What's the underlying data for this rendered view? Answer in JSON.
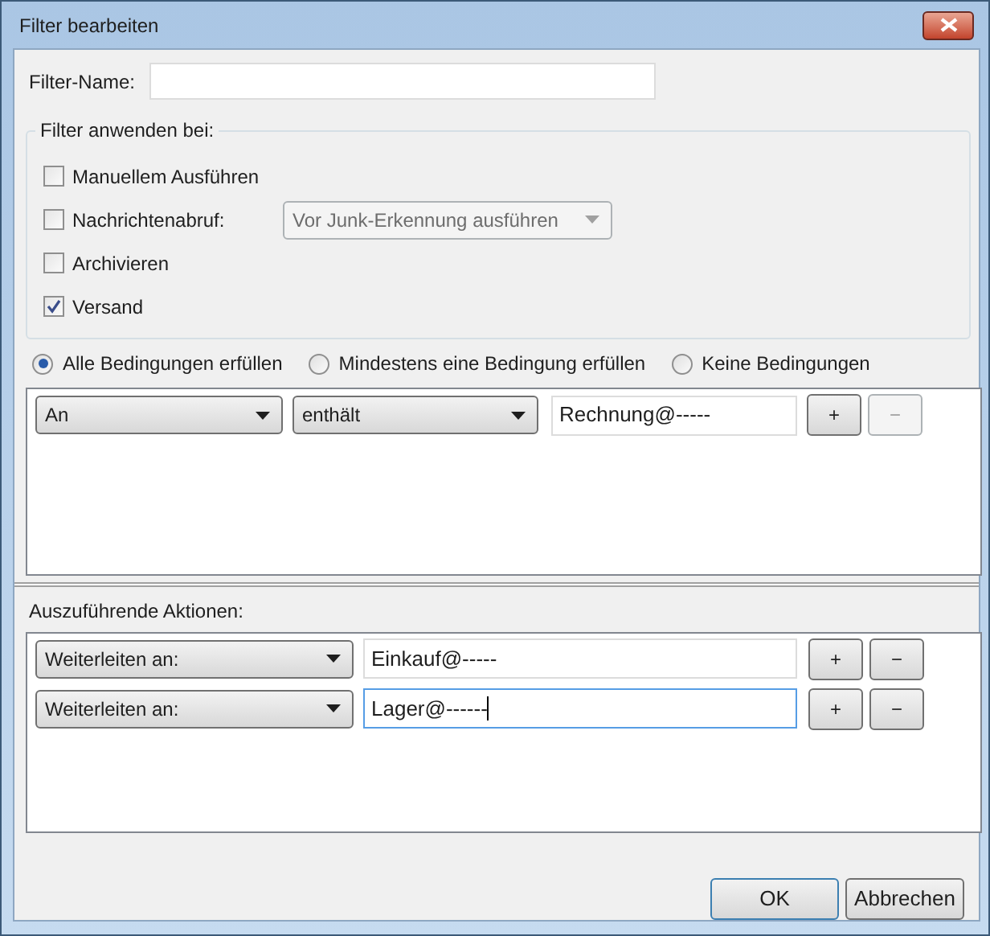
{
  "window": {
    "title": "Filter bearbeiten"
  },
  "filter_name": {
    "label": "Filter-Name:"
  },
  "apply_when": {
    "legend": "Filter anwenden bei:",
    "options": [
      {
        "label": "Manuellem Ausführen",
        "checked": false
      },
      {
        "label": "Nachrichtenabruf:",
        "checked": false,
        "dropdown": {
          "value": "Vor Junk-Erkennung ausführen",
          "disabled": true
        }
      },
      {
        "label": "Archivieren",
        "checked": false
      },
      {
        "label": "Versand",
        "checked": true
      }
    ]
  },
  "match_mode": [
    {
      "label": "Alle Bedingungen erfüllen",
      "selected": true
    },
    {
      "label": "Mindestens eine Bedingung erfüllen",
      "selected": false
    },
    {
      "label": "Keine Bedingungen",
      "selected": false
    }
  ],
  "conditions": [
    {
      "field": "An",
      "operator": "enthält",
      "value": "Rechnung@-----",
      "buttons": [
        {
          "label": "+",
          "disabled": false
        },
        {
          "label": "−",
          "disabled": true
        }
      ]
    }
  ],
  "actions_label": "Auszuführende Aktionen:",
  "actions": [
    {
      "action": "Weiterleiten an:",
      "value": "Einkauf@-----",
      "focused": false,
      "buttons": [
        {
          "label": "+",
          "disabled": false
        },
        {
          "label": "−",
          "disabled": false
        }
      ]
    },
    {
      "action": "Weiterleiten an:",
      "value": "Lager@------",
      "focused": true,
      "buttons": [
        {
          "label": "+",
          "disabled": false
        },
        {
          "label": "−",
          "disabled": false
        }
      ]
    }
  ],
  "buttons": [
    {
      "label": "OK",
      "default": true
    },
    {
      "label": "Abbrechen",
      "default": false
    }
  ]
}
